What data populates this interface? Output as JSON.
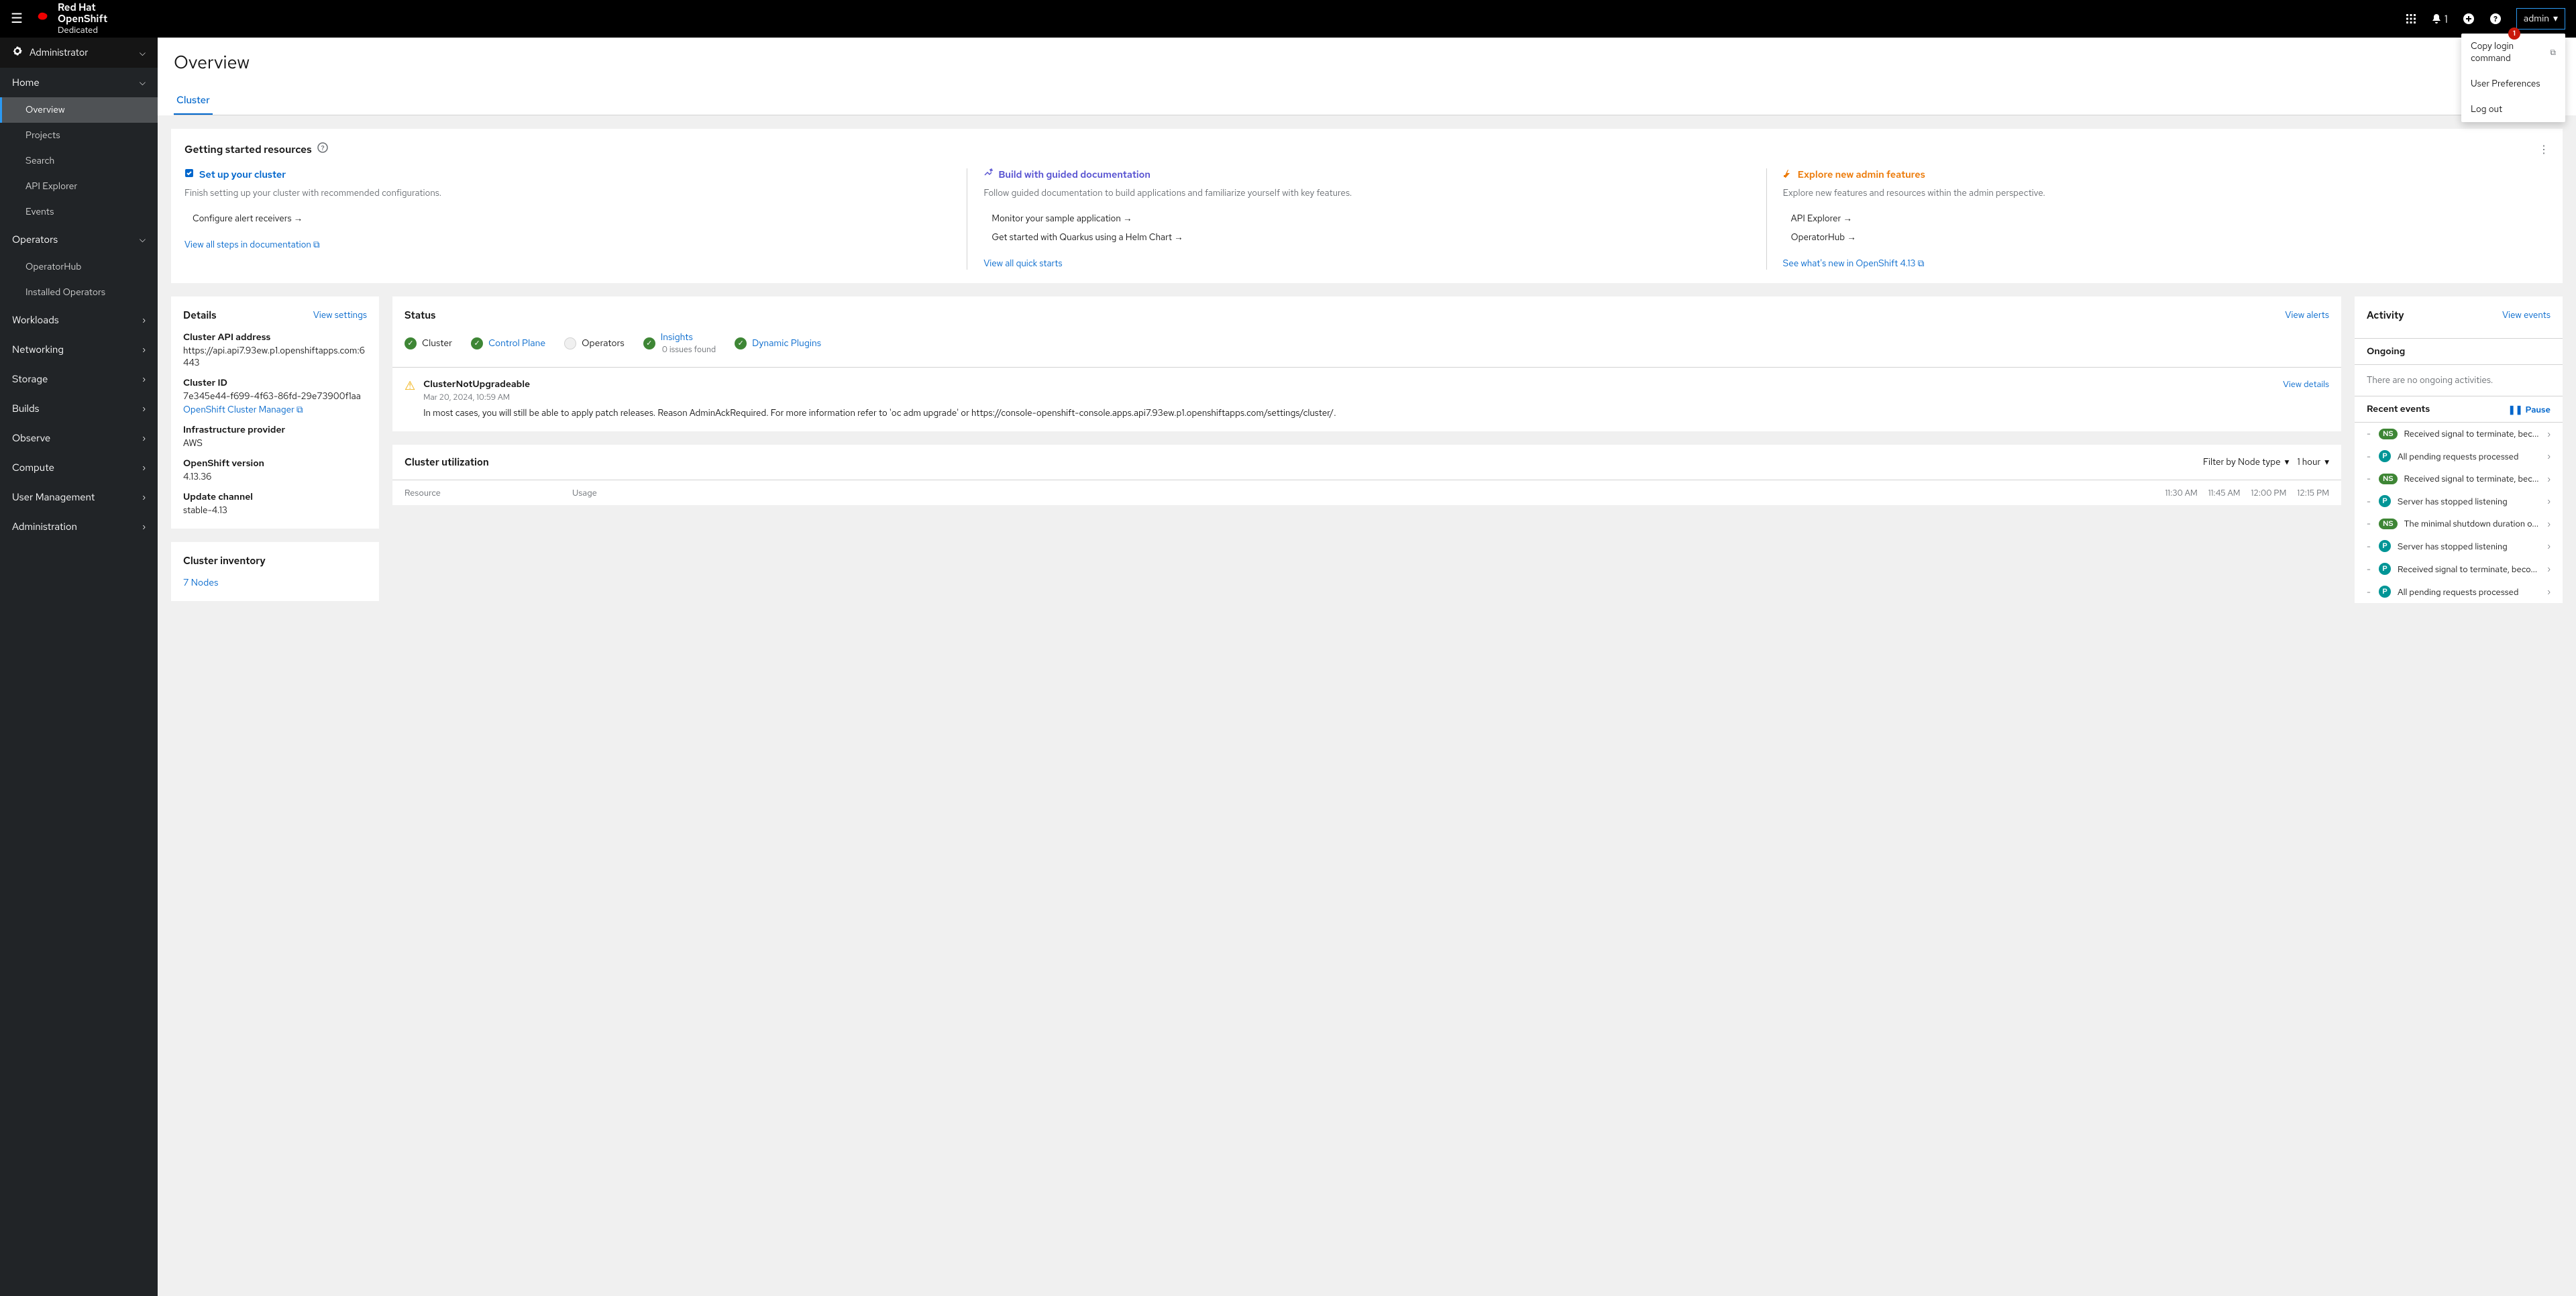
{
  "topbar": {
    "product_top": "Red Hat",
    "product_mid": "OpenShift",
    "product_bot": "Dedicated",
    "bell_count": "1",
    "user": "admin"
  },
  "user_menu": {
    "badge": "1",
    "items": [
      "Copy login command",
      "User Preferences",
      "Log out"
    ]
  },
  "sidebar": {
    "perspective": "Administrator",
    "sections": [
      {
        "label": "Home",
        "open": true,
        "items": [
          "Overview",
          "Projects",
          "Search",
          "API Explorer",
          "Events"
        ],
        "active": "Overview"
      },
      {
        "label": "Operators",
        "open": true,
        "items": [
          "OperatorHub",
          "Installed Operators"
        ]
      },
      {
        "label": "Workloads",
        "open": false
      },
      {
        "label": "Networking",
        "open": false
      },
      {
        "label": "Storage",
        "open": false
      },
      {
        "label": "Builds",
        "open": false
      },
      {
        "label": "Observe",
        "open": false
      },
      {
        "label": "Compute",
        "open": false
      },
      {
        "label": "User Management",
        "open": false
      },
      {
        "label": "Administration",
        "open": false
      }
    ]
  },
  "page": {
    "title": "Overview",
    "tab": "Cluster"
  },
  "gsr": {
    "title": "Getting started resources",
    "cols": [
      {
        "head": "Set up your cluster",
        "desc": "Finish setting up your cluster with recommended configurations.",
        "links": [
          "Configure alert receivers →"
        ],
        "bottom": "View all steps in documentation"
      },
      {
        "head": "Build with guided documentation",
        "desc": "Follow guided documentation to build applications and familiarize yourself with key features.",
        "links": [
          "Monitor your sample application →",
          "Get started with Quarkus using a Helm Chart →"
        ],
        "bottom": "View all quick starts"
      },
      {
        "head": "Explore new admin features",
        "desc": "Explore new features and resources within the admin perspective.",
        "links": [
          "API Explorer →",
          "OperatorHub →"
        ],
        "bottom": "See what's new in OpenShift 4.13"
      }
    ]
  },
  "details": {
    "title": "Details",
    "view": "View settings",
    "items": [
      {
        "label": "Cluster API address",
        "value": "https://api.api7.93ew.p1.openshiftapps.com:6443"
      },
      {
        "label": "Cluster ID",
        "value": "7e345e44-f699-4f63-86fd-29e73900f1aa",
        "extra": "OpenShift Cluster Manager"
      },
      {
        "label": "Infrastructure provider",
        "value": "AWS"
      },
      {
        "label": "OpenShift version",
        "value": "4.13.36"
      },
      {
        "label": "Update channel",
        "value": "stable-4.13"
      }
    ]
  },
  "inventory": {
    "title": "Cluster inventory",
    "nodes": "7 Nodes"
  },
  "status": {
    "title": "Status",
    "view": "View alerts",
    "items": [
      {
        "label": "Cluster",
        "icon": "ok"
      },
      {
        "label": "Control Plane",
        "icon": "ok",
        "link": true
      },
      {
        "label": "Operators",
        "icon": "blank"
      },
      {
        "label": "Insights",
        "sub": "0 issues found",
        "icon": "ok",
        "link": true
      },
      {
        "label": "Dynamic Plugins",
        "icon": "ok",
        "link": true
      }
    ],
    "alert": {
      "title": "ClusterNotUpgradeable",
      "time": "Mar 20, 2024, 10:59 AM",
      "desc": "In most cases, you will still be able to apply patch releases. Reason AdminAckRequired. For more information refer to 'oc adm upgrade' or https://console-openshift-console.apps.api7.93ew.p1.openshiftapps.com/settings/cluster/.",
      "link": "View details"
    }
  },
  "util": {
    "title": "Cluster utilization",
    "filter1": "Filter by Node type",
    "filter2": "1 hour",
    "col_resource": "Resource",
    "col_usage": "Usage",
    "times": [
      "11:30 AM",
      "11:45 AM",
      "12:00 PM",
      "12:15 PM"
    ]
  },
  "activity": {
    "title": "Activity",
    "view": "View events",
    "ongoing": "Ongoing",
    "ongoing_empty": "There are no ongoing activities.",
    "recent": "Recent events",
    "pause": "Pause",
    "events": [
      {
        "badge": "NS",
        "type": "ns",
        "text": "Received signal to terminate, bec..."
      },
      {
        "badge": "P",
        "type": "p",
        "text": "All pending requests processed"
      },
      {
        "badge": "NS",
        "type": "ns",
        "text": "Received signal to terminate, bec..."
      },
      {
        "badge": "P",
        "type": "p",
        "text": "Server has stopped listening"
      },
      {
        "badge": "NS",
        "type": "ns",
        "text": "The minimal shutdown duration o..."
      },
      {
        "badge": "P",
        "type": "p",
        "text": "Server has stopped listening"
      },
      {
        "badge": "P",
        "type": "p",
        "text": "Received signal to terminate, beco..."
      },
      {
        "badge": "P",
        "type": "p",
        "text": "All pending requests processed"
      }
    ]
  }
}
